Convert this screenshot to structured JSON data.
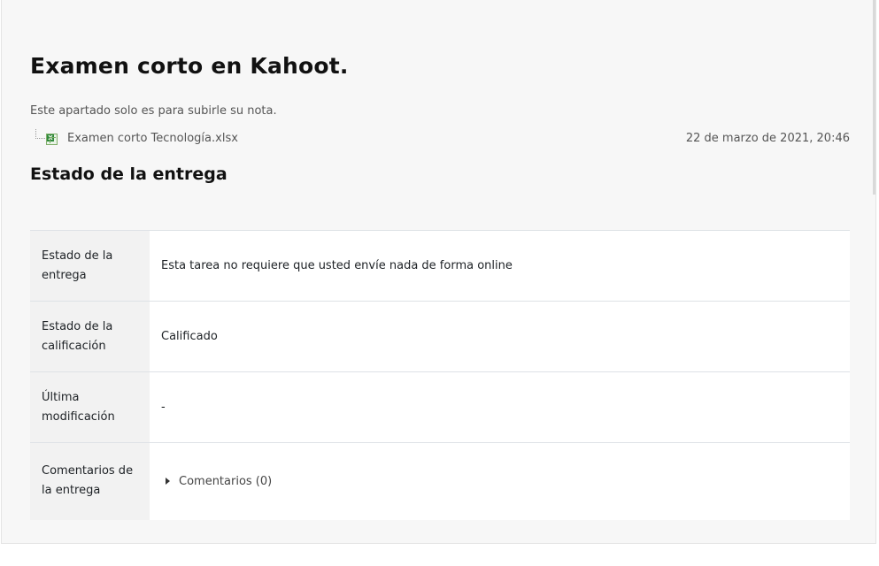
{
  "assignment": {
    "title": "Examen corto en Kahoot.",
    "intro": "Este apartado solo es para subirle su nota.",
    "attachment": {
      "icon": "xlsx-file-icon",
      "filename": "Examen corto Tecnología.xlsx",
      "date": "22 de marzo de 2021, 20:46"
    }
  },
  "submission_status": {
    "heading": "Estado de la entrega",
    "rows": [
      {
        "label": "Estado de la entrega",
        "value": "Esta tarea no requiere que usted envíe nada de forma online"
      },
      {
        "label": "Estado de la calificación",
        "value": "Calificado"
      },
      {
        "label": "Última modificación",
        "value": "-"
      },
      {
        "label": "Comentarios de la entrega",
        "value": "Comentarios (0)"
      }
    ]
  }
}
